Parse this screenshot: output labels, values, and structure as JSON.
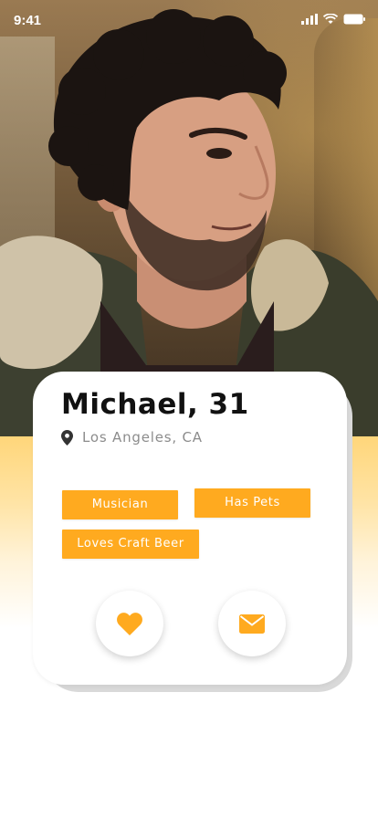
{
  "status_bar": {
    "time": "9:41"
  },
  "profile": {
    "name_age": "Michael, 31",
    "location": "Los Angeles, CA",
    "photo_icon": "profile-photo"
  },
  "tags": [
    {
      "label": "Musician"
    },
    {
      "label": "Has Pets"
    },
    {
      "label": "Loves Craft Beer"
    }
  ],
  "actions": {
    "like_icon": "heart-icon",
    "message_icon": "envelope-icon"
  },
  "colors": {
    "accent": "#ffaa1f",
    "gradient_top": "#ffd67a",
    "text_primary": "#111111",
    "text_secondary": "#8c8c8c"
  }
}
